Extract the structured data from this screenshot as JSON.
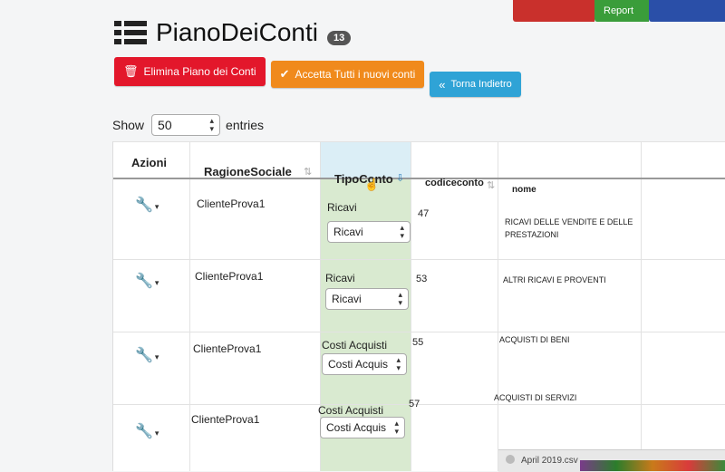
{
  "header": {
    "title": "PianoDeiConti",
    "badge": "13"
  },
  "topbar": {
    "items": [
      "",
      "Report",
      ""
    ]
  },
  "actions": {
    "delete_label": "Elimina Piano dei Conti",
    "accept_label": "Accetta Tutti i nuovi conti",
    "back_label": "Torna Indietro"
  },
  "length_menu": {
    "show_label": "Show",
    "value": "50",
    "entries_label": "entries"
  },
  "table": {
    "columns": [
      "Azioni",
      "RagioneSociale",
      "TipoConto",
      "codiceconto",
      "nome",
      ""
    ],
    "rows": [
      {
        "ragione_sociale": "ClienteProva1",
        "tipo_label": "Ricavi",
        "tipo_select": "Ricavi",
        "codice": "47",
        "nome": "RICAVI DELLE VENDITE E DELLE PRESTAZIONI"
      },
      {
        "ragione_sociale": "ClienteProva1",
        "tipo_label": "Ricavi",
        "tipo_select": "Ricavi",
        "codice": "53",
        "nome": "ALTRI RICAVI E PROVENTI"
      },
      {
        "ragione_sociale": "ClienteProva1",
        "tipo_label": "Costi Acquisti",
        "tipo_select": "Costi Acquis",
        "codice": "55",
        "nome": "ACQUISTI DI BENI"
      },
      {
        "ragione_sociale": "ClienteProva1",
        "tipo_label": "Costi Acquisti",
        "tipo_select": "Costi Acquis",
        "codice": "57",
        "nome": "ACQUISTI DI SERVIZI"
      }
    ]
  },
  "downloads": {
    "file_name": "April 2019.csv"
  },
  "colors": {
    "danger": "#e3172b",
    "warning": "#f08a1c",
    "info": "#2fa3d6",
    "sorted_header": "#dbeef6",
    "sorted_column": "#d9ead0"
  },
  "icons": {
    "title": "list-icon",
    "delete": "trash-icon",
    "accept": "check-circle-icon",
    "back": "double-chevron-left-icon",
    "row_action": "wrench-icon"
  }
}
